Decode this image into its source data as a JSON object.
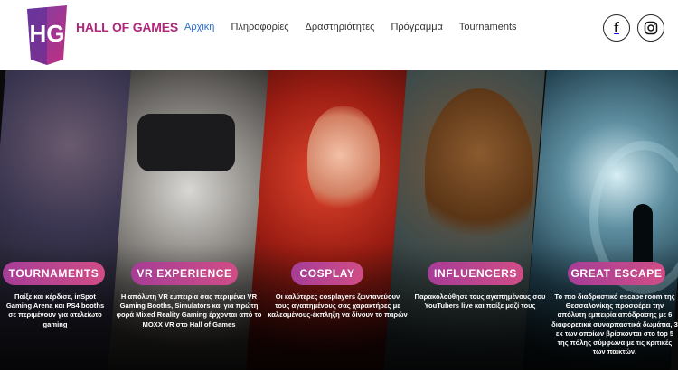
{
  "header": {
    "brand": "HALL OF GAMES",
    "logo_letters": "HG",
    "nav": [
      {
        "label": "Αρχική",
        "active": true
      },
      {
        "label": "Πληροφορίες",
        "active": false
      },
      {
        "label": "Δραστηριότητες",
        "active": false
      },
      {
        "label": "Πρόγραμμα",
        "active": false
      },
      {
        "label": "Tournaments",
        "active": false
      }
    ],
    "social": [
      {
        "icon": "facebook-icon",
        "glyph": "f"
      },
      {
        "icon": "instagram-icon"
      }
    ]
  },
  "panels": [
    {
      "title": "TOURNAMENTS",
      "desc": "Παίξε και κέρδισε, inSpot Gaming Arena και PS4 booths σε περιμένουν για ατελείωτο gaming"
    },
    {
      "title": "VR EXPERIENCE",
      "desc": "Η απόλυτη VR εμπειρία σας περιμένει VR Gaming Booths, Simulators και για πρώτη φορά Mixed Reality Gaming έρχονται από το MOXX VR στο Hall of Games"
    },
    {
      "title": "COSPLAY",
      "desc": "Οι καλύτερες cosplayers ζωντανεύουν τους αγαπημένους σας χαρακτήρες με καλεσμένους-έκπληξη να δίνουν το παρών"
    },
    {
      "title": "INFLUENCERS",
      "desc": "Παρακολούθησε τους αγαπημένους σου YouTubers live και παίξε μαζί τους"
    },
    {
      "title": "GREAT ESCAPE",
      "desc": "Το πιο διαδραστικό escape room της Θεσσαλονίκης προσφέρει την απόλυτη εμπειρία απόδρασης με 6 διαφορετικά συναρπαστικά δωμάτια, 3 εκ των οποίων βρίσκονται στο top 5 της πόλης σύμφωνα με τις κριτικές των παικτών."
    }
  ],
  "colors": {
    "brand": "#b0267b",
    "nav_active": "#2a6fd0",
    "badge_start": "#a63d97",
    "badge_end": "#d04d86"
  }
}
